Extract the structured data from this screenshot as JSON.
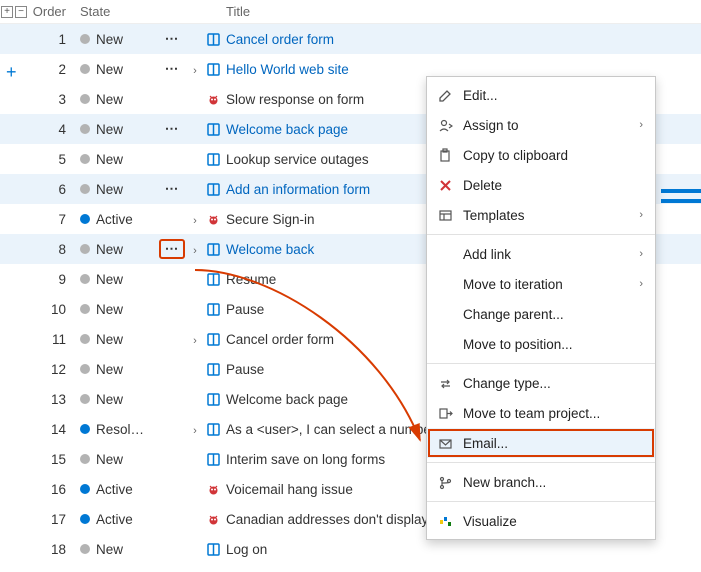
{
  "headers": {
    "order": "Order",
    "state": "State",
    "title": "Title"
  },
  "states": {
    "new": "New",
    "active": "Active",
    "resolved": "Resol…"
  },
  "rows": [
    {
      "order": 1,
      "state": "new",
      "icon": "book",
      "title": "Cancel order form",
      "link": true,
      "more": true,
      "expand": false,
      "sel": true
    },
    {
      "order": 2,
      "state": "new",
      "icon": "book",
      "title": "Hello World web site",
      "link": true,
      "more": true,
      "expand": true,
      "sel": false
    },
    {
      "order": 3,
      "state": "new",
      "icon": "bug",
      "title": "Slow response on form",
      "link": false,
      "more": false,
      "expand": false,
      "sel": false
    },
    {
      "order": 4,
      "state": "new",
      "icon": "book",
      "title": "Welcome back page",
      "link": true,
      "more": true,
      "expand": false,
      "sel": true
    },
    {
      "order": 5,
      "state": "new",
      "icon": "book",
      "title": "Lookup service outages",
      "link": false,
      "more": false,
      "expand": false,
      "sel": false
    },
    {
      "order": 6,
      "state": "new",
      "icon": "book",
      "title": "Add an information form",
      "link": true,
      "more": true,
      "expand": false,
      "sel": true
    },
    {
      "order": 7,
      "state": "active",
      "icon": "bug",
      "title": "Secure Sign-in",
      "link": false,
      "more": false,
      "expand": true,
      "sel": false
    },
    {
      "order": 8,
      "state": "new",
      "icon": "book",
      "title": "Welcome back",
      "link": true,
      "more": "boxed",
      "expand": true,
      "sel": true
    },
    {
      "order": 9,
      "state": "new",
      "icon": "book",
      "title": "Resume",
      "link": false,
      "more": false,
      "expand": false,
      "sel": false
    },
    {
      "order": 10,
      "state": "new",
      "icon": "book",
      "title": "Pause",
      "link": false,
      "more": false,
      "expand": false,
      "sel": false
    },
    {
      "order": 11,
      "state": "new",
      "icon": "book",
      "title": "Cancel order form",
      "link": false,
      "more": false,
      "expand": true,
      "sel": false
    },
    {
      "order": 12,
      "state": "new",
      "icon": "book",
      "title": "Pause",
      "link": false,
      "more": false,
      "expand": false,
      "sel": false
    },
    {
      "order": 13,
      "state": "new",
      "icon": "book",
      "title": "Welcome back page",
      "link": false,
      "more": false,
      "expand": false,
      "sel": false
    },
    {
      "order": 14,
      "state": "resolved",
      "icon": "book",
      "title": "As a <user>, I can select a numbe",
      "link": false,
      "more": false,
      "expand": true,
      "sel": false
    },
    {
      "order": 15,
      "state": "new",
      "icon": "book",
      "title": "Interim save on long forms",
      "link": false,
      "more": false,
      "expand": false,
      "sel": false
    },
    {
      "order": 16,
      "state": "active",
      "icon": "bug",
      "title": "Voicemail hang issue",
      "link": false,
      "more": false,
      "expand": false,
      "sel": false
    },
    {
      "order": 17,
      "state": "active",
      "icon": "bug",
      "title": "Canadian addresses don't display",
      "link": false,
      "more": false,
      "expand": false,
      "sel": false
    },
    {
      "order": 18,
      "state": "new",
      "icon": "book",
      "title": "Log on",
      "link": false,
      "more": false,
      "expand": false,
      "sel": false
    }
  ],
  "menu": [
    {
      "type": "item",
      "icon": "edit",
      "label": "Edit...",
      "sub": false
    },
    {
      "type": "item",
      "icon": "assign",
      "label": "Assign to",
      "sub": true
    },
    {
      "type": "item",
      "icon": "copy",
      "label": "Copy to clipboard",
      "sub": false
    },
    {
      "type": "item",
      "icon": "delete",
      "label": "Delete",
      "sub": false,
      "color": "red"
    },
    {
      "type": "item",
      "icon": "template",
      "label": "Templates",
      "sub": true
    },
    {
      "type": "sep"
    },
    {
      "type": "item",
      "icon": "",
      "label": "Add link",
      "sub": true
    },
    {
      "type": "item",
      "icon": "",
      "label": "Move to iteration",
      "sub": true
    },
    {
      "type": "item",
      "icon": "",
      "label": "Change parent...",
      "sub": false
    },
    {
      "type": "item",
      "icon": "",
      "label": "Move to position...",
      "sub": false
    },
    {
      "type": "sep"
    },
    {
      "type": "item",
      "icon": "change",
      "label": "Change type...",
      "sub": false
    },
    {
      "type": "item",
      "icon": "move",
      "label": "Move to team project...",
      "sub": false
    },
    {
      "type": "item",
      "icon": "email",
      "label": "Email...",
      "sub": false,
      "hl": true,
      "boxed": true
    },
    {
      "type": "sep"
    },
    {
      "type": "item",
      "icon": "branch",
      "label": "New branch...",
      "sub": false
    },
    {
      "type": "sep"
    },
    {
      "type": "item",
      "icon": "visualize",
      "label": "Visualize",
      "sub": false
    }
  ]
}
